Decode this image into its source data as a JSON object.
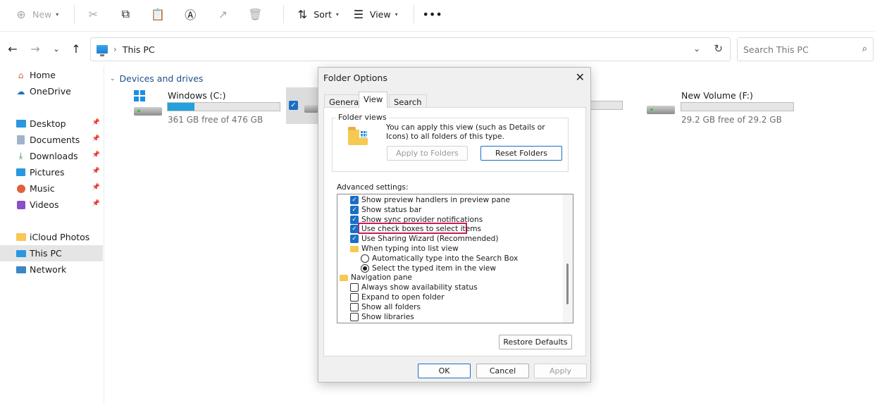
{
  "toolbar": {
    "new_label": "New",
    "sort_label": "Sort",
    "view_label": "View"
  },
  "address": {
    "crumb": "This PC",
    "search_placeholder": "Search This PC"
  },
  "sidebar": {
    "items": [
      {
        "label": "Home",
        "icon": "home-icon"
      },
      {
        "label": "OneDrive",
        "icon": "cloud-icon"
      },
      {
        "label": "Desktop",
        "icon": "desktop-icon"
      },
      {
        "label": "Documents",
        "icon": "documents-icon"
      },
      {
        "label": "Downloads",
        "icon": "download-icon"
      },
      {
        "label": "Pictures",
        "icon": "pictures-icon"
      },
      {
        "label": "Music",
        "icon": "music-icon"
      },
      {
        "label": "Videos",
        "icon": "videos-icon"
      },
      {
        "label": "iCloud Photos",
        "icon": "folder-icon"
      },
      {
        "label": "This PC",
        "icon": "pc-icon"
      },
      {
        "label": "Network",
        "icon": "network-icon"
      }
    ]
  },
  "main": {
    "group_title": "Devices and drives",
    "drives": [
      {
        "name": "Windows (C:)",
        "free": "361 GB free of 476 GB",
        "used_fraction": 0.24
      },
      {
        "name": "New Volume (F:)",
        "free": "29.2 GB free of 29.2 GB",
        "used_fraction": 0.0
      }
    ]
  },
  "dialog": {
    "title": "Folder Options",
    "tabs": [
      "General",
      "View",
      "Search"
    ],
    "active_tab": "View",
    "folder_views_label": "Folder views",
    "folder_views_desc": "You can apply this view (such as Details or Icons) to all folders of this type.",
    "apply_to_folders": "Apply to Folders",
    "reset_folders": "Reset Folders",
    "advanced_label": "Advanced settings:",
    "settings": [
      {
        "type": "checkbox",
        "checked": true,
        "label": "Show preview handlers in preview pane",
        "indent": 1
      },
      {
        "type": "checkbox",
        "checked": true,
        "label": "Show status bar",
        "indent": 1
      },
      {
        "type": "checkbox",
        "checked": true,
        "label": "Show sync provider notifications",
        "indent": 1
      },
      {
        "type": "checkbox",
        "checked": true,
        "label": "Use check boxes to select items",
        "indent": 1
      },
      {
        "type": "checkbox",
        "checked": true,
        "label": "Use Sharing Wizard (Recommended)",
        "indent": 1
      },
      {
        "type": "folder",
        "label": "When typing into list view",
        "indent": 1
      },
      {
        "type": "radio",
        "checked": false,
        "label": "Automatically type into the Search Box",
        "indent": 2
      },
      {
        "type": "radio",
        "checked": true,
        "label": "Select the typed item in the view",
        "indent": 2
      },
      {
        "type": "folder",
        "label": "Navigation pane",
        "indent": 0
      },
      {
        "type": "checkbox",
        "checked": false,
        "label": "Always show availability status",
        "indent": 1
      },
      {
        "type": "checkbox",
        "checked": false,
        "label": "Expand to open folder",
        "indent": 1
      },
      {
        "type": "checkbox",
        "checked": false,
        "label": "Show all folders",
        "indent": 1
      },
      {
        "type": "checkbox",
        "checked": false,
        "label": "Show libraries",
        "indent": 1
      }
    ],
    "restore_defaults": "Restore Defaults",
    "ok": "OK",
    "cancel": "Cancel",
    "apply": "Apply"
  },
  "colors": {
    "accent": "#1a6fc4",
    "highlight": "#d1185a",
    "drive_fill": "#26a0da"
  }
}
